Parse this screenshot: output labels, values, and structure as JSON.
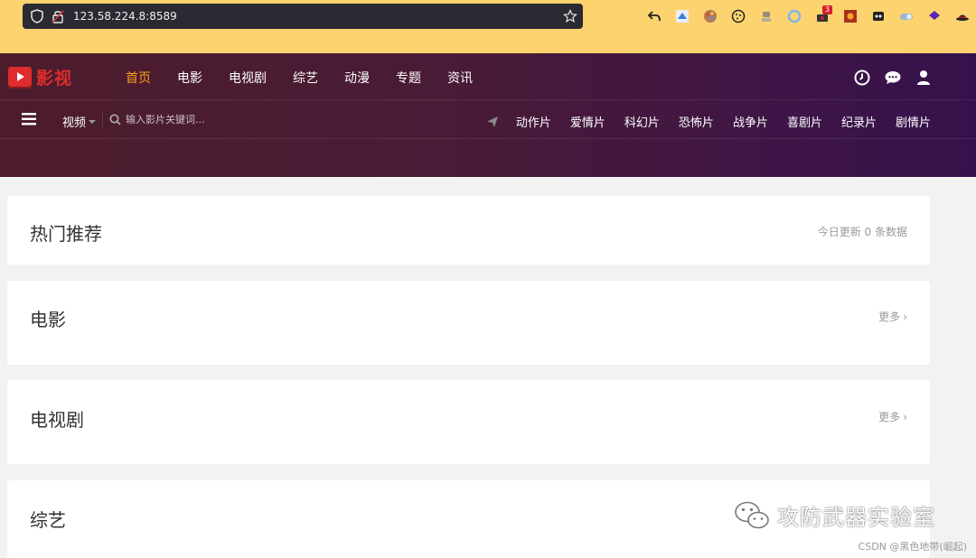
{
  "browser": {
    "url": "123.58.224.8:8589",
    "extension_badge": "3"
  },
  "site": {
    "logo_text": "影视",
    "nav": [
      "首页",
      "电影",
      "电视剧",
      "综艺",
      "动漫",
      "专题",
      "资讯"
    ],
    "active_nav": "首页",
    "accent_color": "#ff9c1e",
    "logo_color": "#e02c2c"
  },
  "search": {
    "type_label": "视频",
    "placeholder": "输入影片关键词..."
  },
  "genres": [
    "动作片",
    "爱情片",
    "科幻片",
    "恐怖片",
    "战争片",
    "喜剧片",
    "纪录片",
    "剧情片"
  ],
  "sections": {
    "hot": {
      "title": "热门推荐",
      "meta": "今日更新 0 条数据"
    },
    "movie": {
      "title": "电影",
      "more": "更多"
    },
    "tv": {
      "title": "电视剧",
      "more": "更多"
    },
    "variety": {
      "title": "综艺"
    }
  },
  "watermark": {
    "text": "攻防武器实验室",
    "credit": "CSDN @黑色地带(崛起)"
  }
}
